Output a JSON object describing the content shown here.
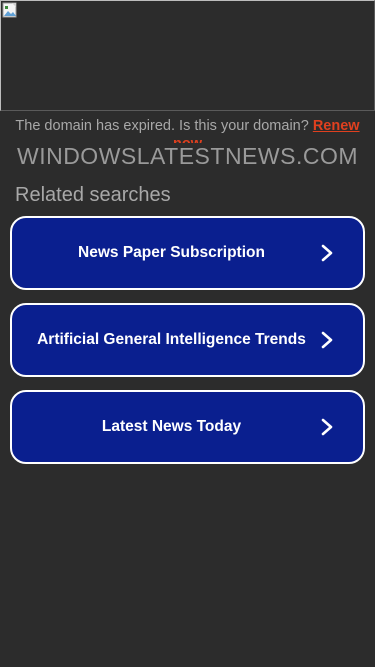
{
  "header": {
    "expired_text": "The domain has expired. Is this your domain? ",
    "renew_label": "Renew now",
    "domain_name": "WINDOWSLATESTNEWS.COM"
  },
  "related": {
    "heading": "Related searches",
    "items": [
      {
        "label": "News Paper Subscription"
      },
      {
        "label": "Artificial General Intelligence Trends"
      },
      {
        "label": "Latest News Today"
      }
    ]
  },
  "colors": {
    "background": "#2c2c2c",
    "button_fill": "#0a1f8f",
    "button_border": "#ffffff",
    "renew_link": "#e0401f"
  },
  "icons": {
    "banner": "broken-image-icon",
    "button_arrow": "chevron-right-icon"
  }
}
